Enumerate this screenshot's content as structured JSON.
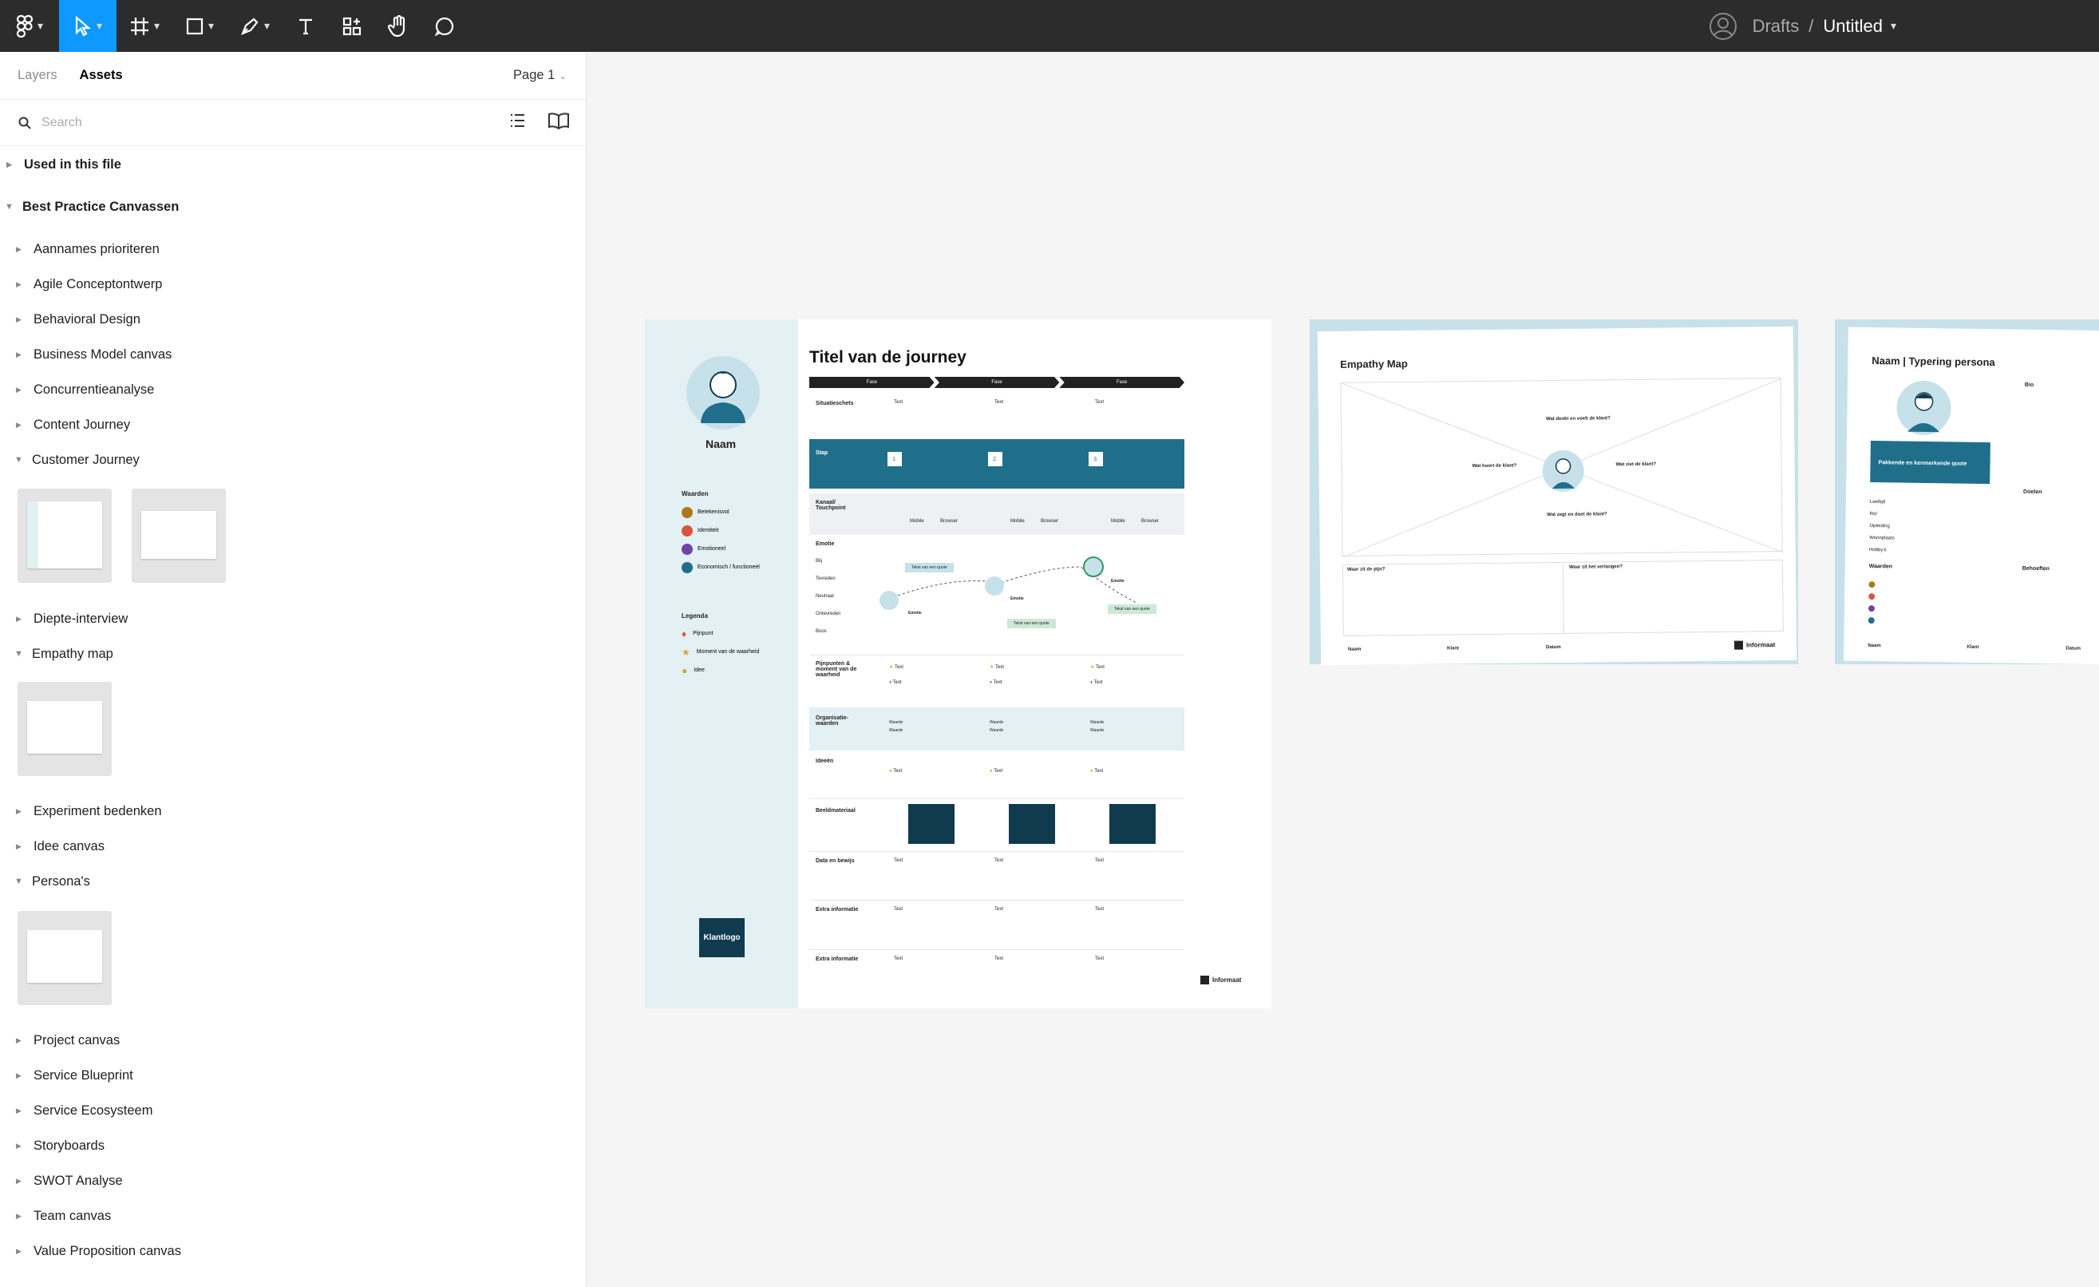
{
  "toolbar": {
    "tools": [
      "main-menu",
      "move-tool",
      "frame-tool",
      "shape-tool",
      "pen-tool",
      "text-tool",
      "resources-tool",
      "hand-tool",
      "comment-tool"
    ],
    "breadcrumb_parent": "Drafts",
    "separator": "/",
    "file_title": "Untitled",
    "accent": "#0d99ff"
  },
  "sidebar": {
    "tabs": [
      "Layers",
      "Assets"
    ],
    "active_tab": "Assets",
    "page_selector": "Page 1",
    "search_placeholder": "Search",
    "used_in_file": "Used in this file",
    "library": "Best Practice Canvassen",
    "items": [
      "Aannames prioriteren",
      "Agile Conceptontwerp",
      "Behavioral Design",
      "Business Model canvas",
      "Concurrentieanalyse",
      "Content Journey",
      "Customer Journey",
      "Diepte-interview",
      "Empathy map",
      "Experiment bedenken",
      "Idee canvas",
      "Persona's",
      "Project canvas",
      "Service Blueprint",
      "Service Ecosysteem",
      "Storyboards",
      "SWOT Analyse",
      "Team canvas",
      "Value Proposition canvas"
    ]
  },
  "canvas": {
    "journey": {
      "title": "Titel van de journey",
      "name": "Naam",
      "phases": [
        "Fase",
        "Fase",
        "Fase"
      ],
      "waarden_title": "Waarden",
      "waarden": [
        "Betekenisvol",
        "Identiteit",
        "Emotioneel",
        "Economisch / functioneel"
      ],
      "legenda_title": "Legenda",
      "legenda": [
        "Pijnpunt",
        "Moment van de waarheid",
        "Idee"
      ],
      "rows": [
        "Situatieschets",
        "Stap",
        "Kanaal/ Touchpoint",
        "Emotie",
        "Pijnpunten & moment van de waarheid",
        "Organisatie-waarden",
        "Ideeën",
        "Beeldmateriaal",
        "Data en bewijs",
        "Extra informatie",
        "Extra informatie"
      ],
      "emotions": [
        "Blij",
        "Tevreden",
        "Neutraal",
        "Ontevreden",
        "Boos"
      ],
      "step_numbers": [
        "1.",
        "2.",
        "3."
      ],
      "cell_text": "Text",
      "emotie_label": "Emotie",
      "quote": "Tekst van een quote",
      "channels": [
        "Mobile",
        "Browser"
      ],
      "org_values": [
        "Waarde",
        "Waarde"
      ],
      "klantlogo": "Klantlogo",
      "brand": "Informaat"
    },
    "empathy": {
      "title": "Empathy Map",
      "questions": [
        "Wat denkt en voelt de klant?",
        "Wat hoort de klant?",
        "Wat ziet de klant?",
        "Wat zegt en doet de klant?",
        "Waar zit de pijn?",
        "Waar zit het verlangen?"
      ],
      "footer": [
        "Naam",
        "Klant",
        "Datum"
      ],
      "brand": "Informaat"
    },
    "persona": {
      "title": "Naam | Typering persona",
      "bio": "Bio",
      "quote": "Pakkende en kenmerkende quote",
      "doelen": "Doelen",
      "fields": [
        "Leeftijd",
        "Rol",
        "Opleiding",
        "Woonplaats",
        "Hobby's"
      ],
      "waarden": "Waarden",
      "behoeften": "Behoeften",
      "footer": [
        "Naam",
        "Klant",
        "Datum"
      ]
    }
  },
  "colors": {
    "teal": "#1f6f8b",
    "light_teal": "#e3f0f4",
    "dark_navy": "#103b4e",
    "toolbar_bg": "#2c2c2c"
  }
}
